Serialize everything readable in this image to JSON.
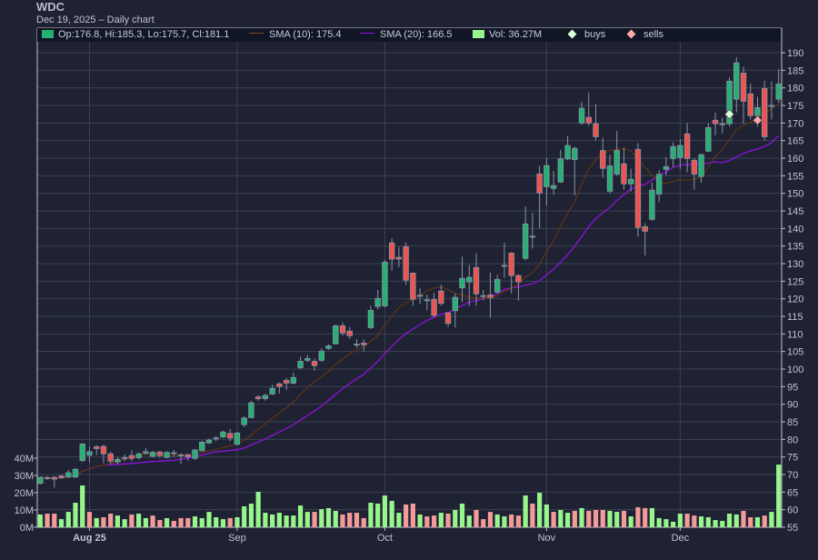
{
  "header": {
    "title": "WDC",
    "subtitle": "Dec 19, 2025 – Daily chart"
  },
  "legend": {
    "ohlc": "Op:176.8, Hi:185.3, Lo:175.7, Cl:181.1",
    "sma10": "SMA (10): 175.4",
    "sma20": "SMA (20): 166.5",
    "vol": "Vol: 36.27M",
    "buys": "buys",
    "sells": "sells"
  },
  "colors": {
    "background": "#1e2233",
    "grid": "#3c4253",
    "up": "#26b074",
    "down": "#ef5350",
    "candle_border": "#8a94a6",
    "vol_up": "#98f58c",
    "vol_down": "#f49a9a",
    "sma10": "#5c3514",
    "sma20": "#9010e0",
    "buy": "#d9ffd9",
    "sell": "#ffa8a8"
  },
  "chart_data": {
    "type": "candlestick",
    "title": "WDC",
    "subtitle": "Dec 19, 2025 – Daily chart",
    "price_ticks": [
      190,
      185,
      180,
      175,
      170,
      165,
      160,
      155,
      150,
      145,
      140,
      135,
      130,
      125,
      120,
      115,
      110,
      105,
      100,
      95,
      90,
      85,
      80,
      75,
      70,
      65,
      60,
      55
    ],
    "ylim": [
      55,
      190
    ],
    "volume_ticks": [
      "40M",
      "30M",
      "20M",
      "10M",
      "0M"
    ],
    "volume_ylim_millions": [
      0,
      40
    ],
    "x_ticks": [
      {
        "label": "Aug 25",
        "bar": 7,
        "bold": true
      },
      {
        "label": "Sep",
        "bar": 28,
        "bold": false
      },
      {
        "label": "Oct",
        "bar": 49,
        "bold": false
      },
      {
        "label": "Nov",
        "bar": 72,
        "bold": false
      },
      {
        "label": "Dec",
        "bar": 91,
        "bold": false
      }
    ],
    "ohlc": [
      [
        67.5,
        69.5,
        67.2,
        69.2
      ],
      [
        69.0,
        69.6,
        68.5,
        69.1
      ],
      [
        69.2,
        69.6,
        66.3,
        68.7
      ],
      [
        69.6,
        69.9,
        68.8,
        69.1
      ],
      [
        69.3,
        71.3,
        69.0,
        70.5
      ],
      [
        69.3,
        71.8,
        69.0,
        71.5
      ],
      [
        74.0,
        79.0,
        73.5,
        78.7
      ],
      [
        75.5,
        78.0,
        73.5,
        76.5
      ],
      [
        77.9,
        78.4,
        75.5,
        77.4
      ],
      [
        78.0,
        78.5,
        73.2,
        75.9
      ],
      [
        75.9,
        76.5,
        73.0,
        73.8
      ],
      [
        73.6,
        75.0,
        72.8,
        74.3
      ],
      [
        74.7,
        75.7,
        73.8,
        74.8
      ],
      [
        75.4,
        77.0,
        73.8,
        74.6
      ],
      [
        74.8,
        76.3,
        74.3,
        75.9
      ],
      [
        76.1,
        77.5,
        75.7,
        76.5
      ],
      [
        75.2,
        76.8,
        74.8,
        76.3
      ],
      [
        76.4,
        76.8,
        74.8,
        75.4
      ],
      [
        74.9,
        76.6,
        74.6,
        76.3
      ],
      [
        76.1,
        77.0,
        75.0,
        76.2
      ],
      [
        75.6,
        76.0,
        73.0,
        75.6
      ],
      [
        75.6,
        76.0,
        74.0,
        75.0
      ],
      [
        74.6,
        77.3,
        74.2,
        77.0
      ],
      [
        76.8,
        79.7,
        76.5,
        79.2
      ],
      [
        79.0,
        80.2,
        78.7,
        79.8
      ],
      [
        80.3,
        81.0,
        79.5,
        80.4
      ],
      [
        80.7,
        82.5,
        80.4,
        82.1
      ],
      [
        81.7,
        83.0,
        79.5,
        80.4
      ],
      [
        78.6,
        82.2,
        78.3,
        81.8
      ],
      [
        84.2,
        86.5,
        83.5,
        86.1
      ],
      [
        86.2,
        91.0,
        86.0,
        90.4
      ],
      [
        92.1,
        92.5,
        91.0,
        91.6
      ],
      [
        91.6,
        93.0,
        91.0,
        92.5
      ],
      [
        92.9,
        95.5,
        92.7,
        94.5
      ],
      [
        95.8,
        96.2,
        93.0,
        95.0
      ],
      [
        96.8,
        97.5,
        94.0,
        96.0
      ],
      [
        96.0,
        99.0,
        95.6,
        97.6
      ],
      [
        100.4,
        103.5,
        100.0,
        102.2
      ],
      [
        102.5,
        104.0,
        102.0,
        103.0
      ],
      [
        102.2,
        103.0,
        99.5,
        101.0
      ],
      [
        102.5,
        106.0,
        102.0,
        105.1
      ],
      [
        105.9,
        107.0,
        105.5,
        106.6
      ],
      [
        107.2,
        112.7,
        107.0,
        112.3
      ],
      [
        112.3,
        113.3,
        109.5,
        110.3
      ],
      [
        110.8,
        112.0,
        108.5,
        109.5
      ],
      [
        107.0,
        108.5,
        106.0,
        107.1
      ],
      [
        107.4,
        108.5,
        105.0,
        106.9
      ],
      [
        111.8,
        118.0,
        111.4,
        116.7
      ],
      [
        117.8,
        122.5,
        117.0,
        120.1
      ],
      [
        118.0,
        131.0,
        117.6,
        130.4
      ],
      [
        135.9,
        137.2,
        128.0,
        131.3
      ],
      [
        131.8,
        134.7,
        129.0,
        131.3
      ],
      [
        134.8,
        136.0,
        124.0,
        125.3
      ],
      [
        127.3,
        127.5,
        118.0,
        119.9
      ],
      [
        121.0,
        123.0,
        118.5,
        121.0
      ],
      [
        119.6,
        121.2,
        116.7,
        119.7
      ],
      [
        119.8,
        121.7,
        114.7,
        115.3
      ],
      [
        122.2,
        124.0,
        118.0,
        118.7
      ],
      [
        116.0,
        116.3,
        112.0,
        113.0
      ],
      [
        116.6,
        121.5,
        111.8,
        120.4
      ],
      [
        123.1,
        132.0,
        119.0,
        125.8
      ],
      [
        124.8,
        129.6,
        117.9,
        126.1
      ],
      [
        128.9,
        133.0,
        118.0,
        121.4
      ],
      [
        120.8,
        122.5,
        119.5,
        120.9
      ],
      [
        121.1,
        127.5,
        114.5,
        120.4
      ],
      [
        121.9,
        126.8,
        121.5,
        125.5
      ],
      [
        129.4,
        136.0,
        126.0,
        129.5
      ],
      [
        133.0,
        133.3,
        121.5,
        126.6
      ],
      [
        126.6,
        127.0,
        119.5,
        124.8
      ],
      [
        131.5,
        146.3,
        131.0,
        141.3
      ],
      [
        137.7,
        144.5,
        134.3,
        137.8
      ],
      [
        155.5,
        157.8,
        140.0,
        150.1
      ],
      [
        151.9,
        160.0,
        146.5,
        157.9
      ],
      [
        151.4,
        156.3,
        149.6,
        152.2
      ],
      [
        153.2,
        162.4,
        153.0,
        159.8
      ],
      [
        159.8,
        166.3,
        159.4,
        163.6
      ],
      [
        159.6,
        163.3,
        149.4,
        162.8
      ],
      [
        170.0,
        176.0,
        169.5,
        174.2
      ],
      [
        171.6,
        178.7,
        169.2,
        170.0
      ],
      [
        169.8,
        175.4,
        165.0,
        166.1
      ],
      [
        162.2,
        165.8,
        154.4,
        157.1
      ],
      [
        150.6,
        161.0,
        150.0,
        157.8
      ],
      [
        155.5,
        167.7,
        155.0,
        162.2
      ],
      [
        158.4,
        163.0,
        151.0,
        152.7
      ],
      [
        152.7,
        157.0,
        150.5,
        154.0
      ],
      [
        162.5,
        164.3,
        137.7,
        140.3
      ],
      [
        140.5,
        141.5,
        132.3,
        139.2
      ],
      [
        142.6,
        153.0,
        142.3,
        150.9
      ],
      [
        149.8,
        156.6,
        147.5,
        155.4
      ],
      [
        156.8,
        160.3,
        155.0,
        157.6
      ],
      [
        159.9,
        164.5,
        157.5,
        163.3
      ],
      [
        160.2,
        165.5,
        157.0,
        163.6
      ],
      [
        166.9,
        170.0,
        156.0,
        159.9
      ],
      [
        159.4,
        160.0,
        151.0,
        155.5
      ],
      [
        154.8,
        161.2,
        153.0,
        161.0
      ],
      [
        162.0,
        170.0,
        161.8,
        168.7
      ],
      [
        170.8,
        173.0,
        166.5,
        169.8
      ],
      [
        169.8,
        171.5,
        167.0,
        169.8
      ],
      [
        169.8,
        183.0,
        169.0,
        181.9
      ],
      [
        176.8,
        188.7,
        173.0,
        187.1
      ],
      [
        184.2,
        186.0,
        169.8,
        176.2
      ],
      [
        178.3,
        181.2,
        171.0,
        172.1
      ],
      [
        172.1,
        177.5,
        169.0,
        174.4
      ],
      [
        179.8,
        182.0,
        165.0,
        166.1
      ],
      [
        175.0,
        181.8,
        171.0,
        175.0
      ],
      [
        176.8,
        185.3,
        175.7,
        181.1
      ]
    ],
    "volume_millions": [
      7.4,
      7.9,
      7.9,
      4.7,
      8.9,
      14.2,
      24.2,
      8.9,
      5.3,
      5.8,
      7.9,
      6.8,
      4.7,
      7.4,
      7.9,
      5.3,
      6.8,
      4.2,
      5.3,
      3.7,
      5.3,
      5.3,
      6.3,
      5.3,
      8.9,
      5.8,
      4.7,
      5.3,
      5.8,
      12.1,
      13.7,
      20.5,
      8.4,
      7.4,
      8.4,
      6.8,
      6.8,
      12.6,
      8.9,
      8.9,
      10.5,
      11.1,
      9.5,
      7.4,
      8.4,
      8.4,
      5.3,
      14.2,
      13.7,
      18.4,
      15.3,
      8.4,
      13.2,
      13.7,
      7.4,
      6.3,
      6.8,
      8.4,
      7.9,
      10.0,
      13.7,
      6.8,
      10.0,
      4.7,
      8.9,
      7.4,
      6.3,
      7.4,
      6.8,
      18.4,
      13.7,
      20.0,
      13.2,
      8.9,
      10.0,
      8.4,
      9.5,
      11.1,
      9.5,
      10.0,
      10.0,
      9.5,
      8.9,
      9.5,
      6.3,
      11.6,
      11.1,
      11.1,
      5.3,
      4.7,
      3.2,
      7.9,
      7.9,
      6.8,
      6.3,
      5.8,
      4.2,
      3.7,
      7.9,
      7.4,
      9.5,
      5.8,
      5.8,
      6.8,
      8.9,
      36.27
    ],
    "sma_periods": [
      10,
      20
    ],
    "markers": [
      {
        "type": "buys",
        "bar": 98,
        "price": 172.5
      },
      {
        "type": "sells",
        "bar": 102,
        "price": 170.8
      }
    ]
  }
}
